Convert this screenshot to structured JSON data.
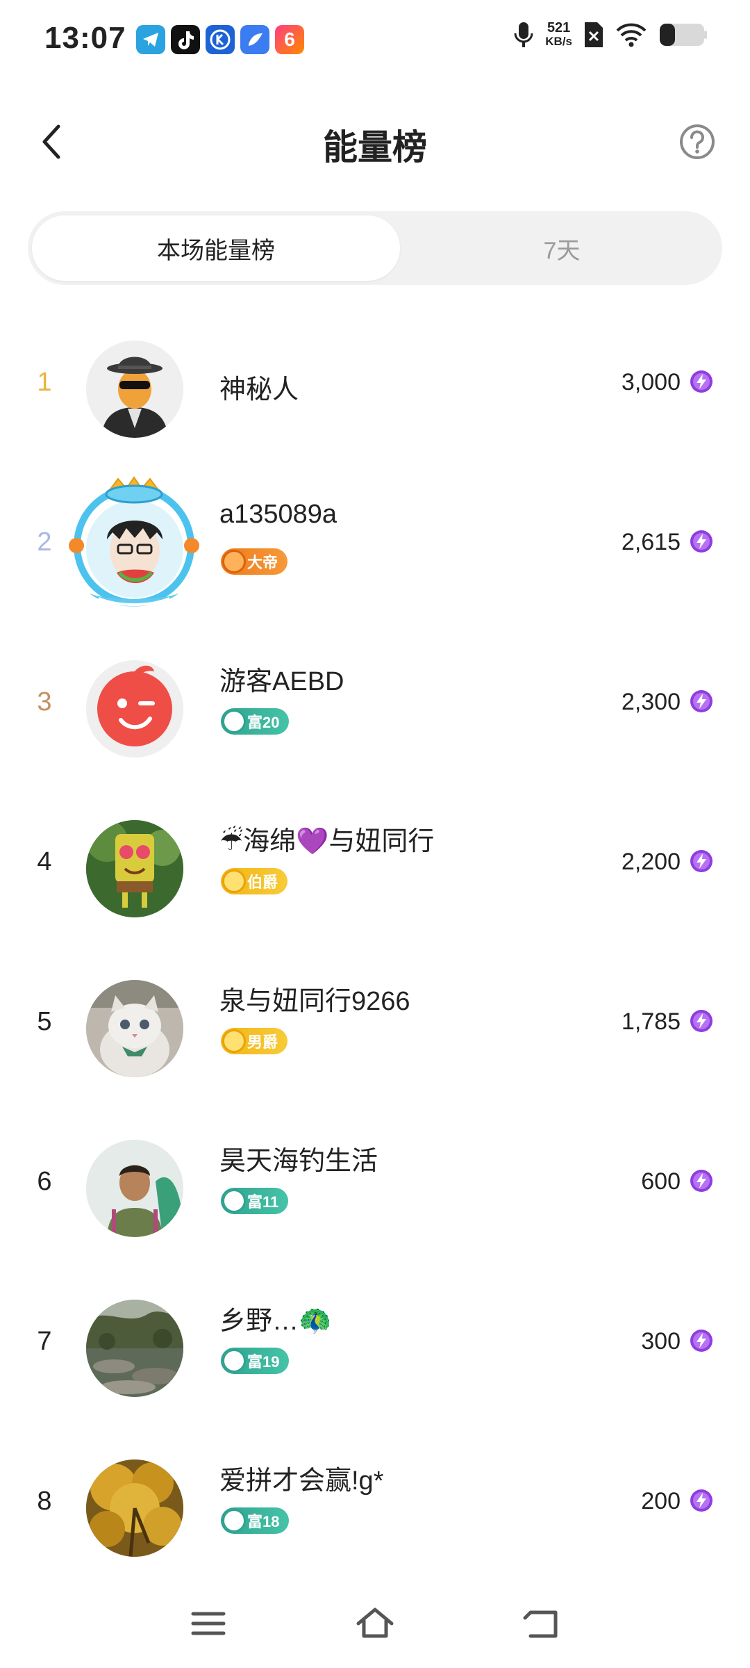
{
  "status_bar": {
    "time": "13:07",
    "net_speed_value": "521",
    "net_speed_unit": "KB/s",
    "app_icons": [
      "telegram-icon",
      "tiktok-icon",
      "k-app-icon",
      "browser-icon",
      "six-app-icon"
    ]
  },
  "header": {
    "title": "能量榜"
  },
  "tabs": [
    {
      "label": "本场能量榜",
      "active": true
    },
    {
      "label": "7天",
      "active": false
    }
  ],
  "ranking": [
    {
      "rank": "1",
      "name": "神秘人",
      "score": "3,000",
      "badge": null
    },
    {
      "rank": "2",
      "name": "a135089a",
      "score": "2,615",
      "badge": {
        "label": "大帝",
        "style": "orange"
      }
    },
    {
      "rank": "3",
      "name": "游客AEBD",
      "score": "2,300",
      "badge": {
        "label": "富20",
        "style": "fu"
      }
    },
    {
      "rank": "4",
      "name": "☔海绵💜与妞同行",
      "score": "2,200",
      "badge": {
        "label": "伯爵",
        "style": "gold"
      }
    },
    {
      "rank": "5",
      "name": "泉与妞同行9266",
      "score": "1,785",
      "badge": {
        "label": "男爵",
        "style": "gold"
      }
    },
    {
      "rank": "6",
      "name": "昊天海钓生活",
      "score": "600",
      "badge": {
        "label": "富11",
        "style": "fu"
      }
    },
    {
      "rank": "7",
      "name": "乡野…🦚",
      "score": "300",
      "badge": {
        "label": "富19",
        "style": "fu"
      }
    },
    {
      "rank": "8",
      "name": "爱拼才会赢!g*",
      "score": "200",
      "badge": {
        "label": "富18",
        "style": "fu"
      }
    }
  ],
  "colors": {
    "rank1": "#e8b53a",
    "rank2": "#a9b6e6",
    "rank3": "#c39161",
    "energy_icon": "#8e3ee0",
    "tab_bg": "#f1f1f1"
  },
  "navbar": {
    "icons": [
      "menu-icon",
      "home-icon",
      "back-nav-icon"
    ]
  }
}
